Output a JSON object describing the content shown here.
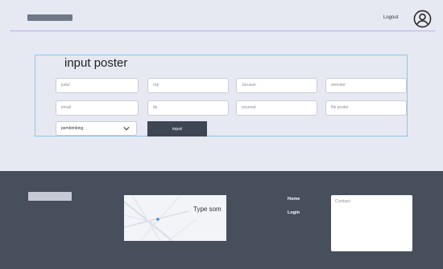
{
  "header": {
    "logout_label": "Logout",
    "user_icon": "user-circle-icon"
  },
  "form": {
    "title": "input poster",
    "fields": [
      {
        "placeholder": "judul"
      },
      {
        "placeholder": "nrp"
      },
      {
        "placeholder": "Jurusan"
      },
      {
        "placeholder": "semster"
      },
      {
        "placeholder": "email"
      },
      {
        "placeholder": "tlp"
      },
      {
        "placeholder": "sosmed"
      },
      {
        "placeholder": "file poster"
      }
    ],
    "select": {
      "value": "pembimbing",
      "icon": "chevron-down-icon"
    },
    "submit_label": "input"
  },
  "footer": {
    "map_text": "Type som",
    "links": [
      "Home",
      "Login"
    ],
    "contact_placeholder": "Contact"
  },
  "colors": {
    "background": "#e6e9f2",
    "footer": "#474e5c",
    "button": "#3e4653",
    "form_border": "#8fc6ea",
    "map_pin": "#3d8fe0"
  }
}
